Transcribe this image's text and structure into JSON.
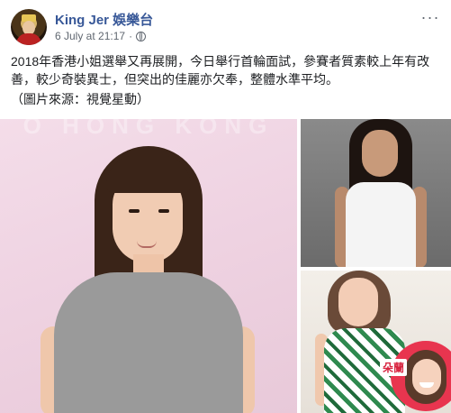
{
  "post": {
    "page_name": "King Jer 娛樂台",
    "timestamp": "6 July at 21:17",
    "separator": "·",
    "privacy_icon": "globe-icon",
    "more_label": "···",
    "text_line1": "2018年香港小姐選舉又再展開，今日舉行首輪面試，參賽者質素較上年有改善，較少奇裝異士，但突出的佳麗亦欠奉，整體水準平均。",
    "text_line2": "（圖片來源：視覺星動）"
  },
  "photos": {
    "main_watermark": "O HONG KONG",
    "inset_caption": "朵蘭"
  },
  "colors": {
    "link_blue": "#385898",
    "text": "#1c1e21",
    "meta_gray": "#606770"
  }
}
